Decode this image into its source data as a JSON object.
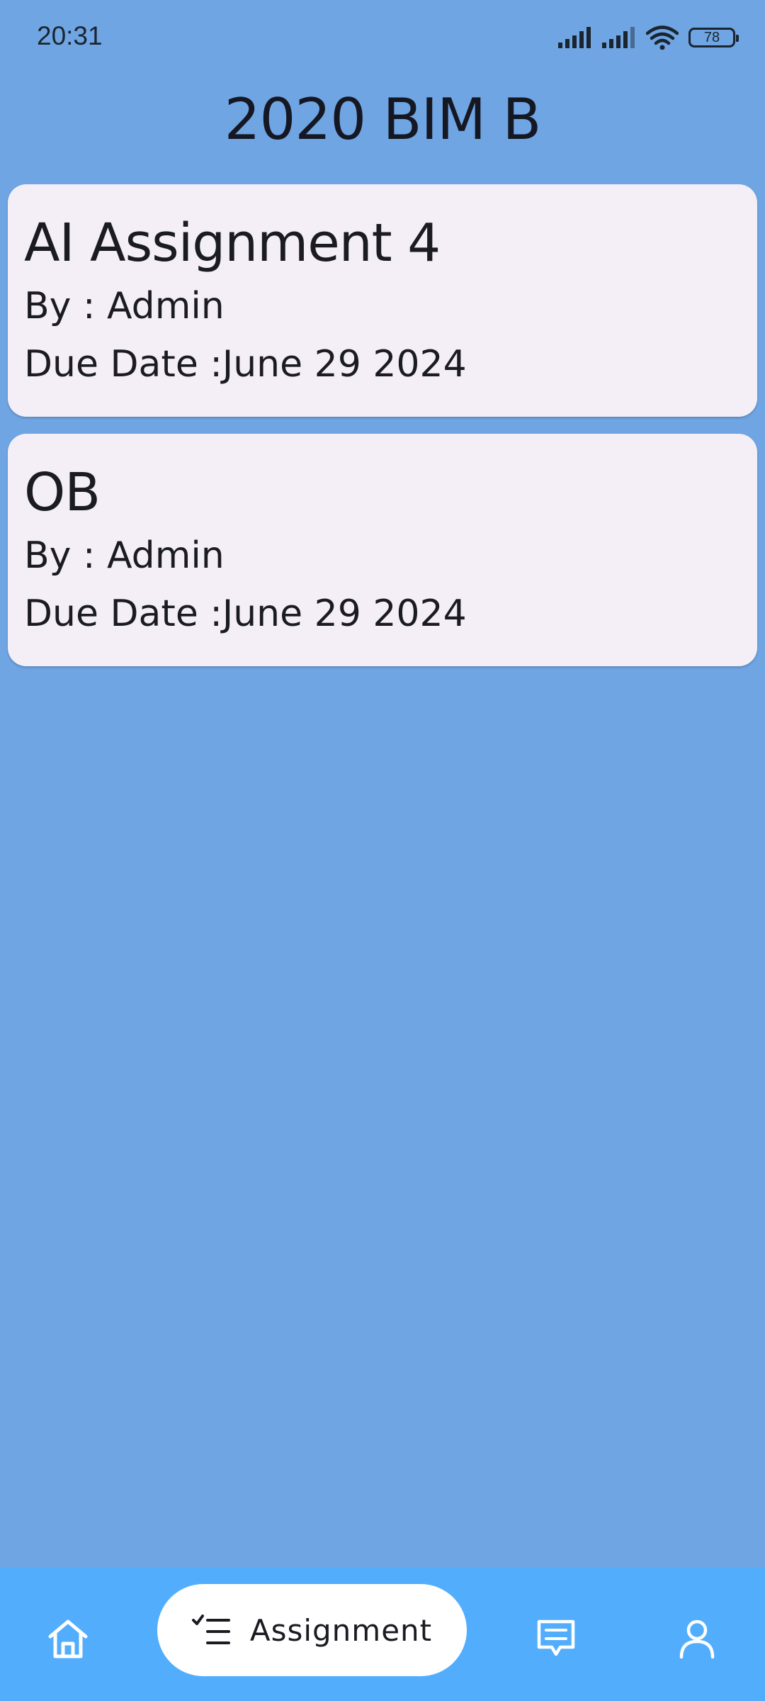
{
  "status_bar": {
    "time": "20:31",
    "battery_level": "78",
    "icons": [
      "signal-icon",
      "signal-icon",
      "wifi-icon",
      "battery-icon"
    ]
  },
  "header": {
    "title": "2020 BIM B"
  },
  "assignments": [
    {
      "title": "AI Assignment 4",
      "author": "By : Admin",
      "due": "Due Date :June 29 2024"
    },
    {
      "title": "OB",
      "author": "By : Admin",
      "due": "Due Date :June 29 2024"
    }
  ],
  "bottom_nav": {
    "items": [
      {
        "icon": "home-icon",
        "label": ""
      },
      {
        "icon": "checklist-icon",
        "label": "Assignment",
        "active": true
      },
      {
        "icon": "chat-icon",
        "label": ""
      },
      {
        "icon": "profile-icon",
        "label": ""
      }
    ]
  },
  "colors": {
    "background": "#6fa5e3",
    "card": "#f4eff7",
    "nav_bar": "#52aefc",
    "nav_active_pill": "#ffffff"
  }
}
